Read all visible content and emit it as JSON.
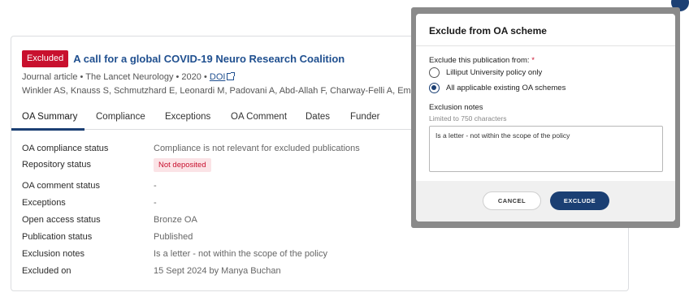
{
  "publication": {
    "badge": "Excluded",
    "title": "A call for a global COVID-19 Neuro Research Coalition",
    "meta_prefix": "Journal article • The Lancet Neurology • 2020 • ",
    "doi_label": "DOI",
    "authors": "Winkler AS, Knauss S, Schmutzhard E, Leonardi M, Padovani A, Abd-Allah F, Charway-Felli A, Emr"
  },
  "tabs": [
    "OA Summary",
    "Compliance",
    "Exceptions",
    "OA Comment",
    "Dates",
    "Funder"
  ],
  "summary": {
    "rows": [
      {
        "key": "OA compliance status",
        "value": "Compliance is not relevant for excluded publications"
      },
      {
        "key": "Repository status",
        "value": "Not deposited"
      },
      {
        "key": "OA comment status",
        "value": "-"
      },
      {
        "key": "Exceptions",
        "value": "-"
      },
      {
        "key": "Open access status",
        "value": "Bronze OA"
      },
      {
        "key": "Publication status",
        "value": "Published"
      },
      {
        "key": "Exclusion notes",
        "value": "Is a letter - not within the scope of the policy"
      },
      {
        "key": "Excluded on",
        "value": "15 Sept 2024 by Manya Buchan"
      }
    ]
  },
  "modal": {
    "title": "Exclude from OA scheme",
    "exclude_label": "Exclude this publication from:",
    "required_mark": "*",
    "options": [
      {
        "label": "Lilliput University policy only",
        "checked": false
      },
      {
        "label": "All applicable existing OA schemes",
        "checked": true
      }
    ],
    "notes_label": "Exclusion notes",
    "notes_hint": "Limited to 750 characters",
    "notes_value": "Is a letter - not within the scope of the policy",
    "cancel_label": "CANCEL",
    "exclude_label_btn": "EXCLUDE"
  },
  "colors": {
    "brand": "#1b3f73",
    "danger": "#c8102e"
  }
}
